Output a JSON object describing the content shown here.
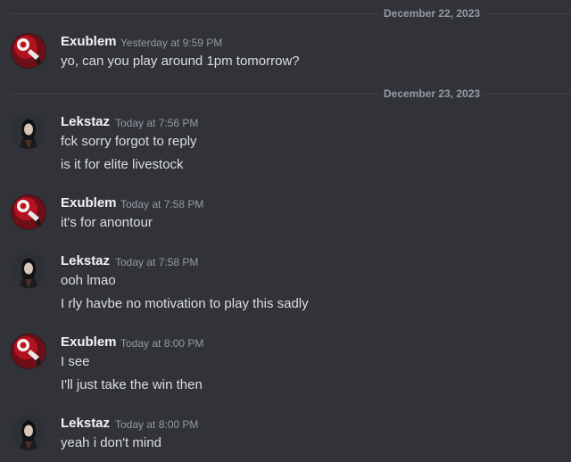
{
  "dividers": [
    {
      "date": "December 22, 2023"
    },
    {
      "date": "December 23, 2023"
    }
  ],
  "messages": [
    {
      "author": "Exublem",
      "avatar_icon": "red-lamp-avatar-icon",
      "timestamp": "Yesterday at 9:59 PM",
      "lines": [
        "yo, can you play around 1pm tomorrow?"
      ]
    },
    {
      "author": "Lekstaz",
      "avatar_icon": "dark-haired-character-avatar-icon",
      "timestamp": "Today at 7:56 PM",
      "lines": [
        "fck sorry forgot to reply",
        "is it for elite livestock"
      ]
    },
    {
      "author": "Exublem",
      "avatar_icon": "red-lamp-avatar-icon",
      "timestamp": "Today at 7:58 PM",
      "lines": [
        "it's for anontour"
      ]
    },
    {
      "author": "Lekstaz",
      "avatar_icon": "dark-haired-character-avatar-icon",
      "timestamp": "Today at 7:58 PM",
      "lines": [
        "ooh lmao",
        "I rly havbe no motivation to play this sadly"
      ]
    },
    {
      "author": "Exublem",
      "avatar_icon": "red-lamp-avatar-icon",
      "timestamp": "Today at 8:00 PM",
      "lines": [
        "I see",
        "I'll just take the win then"
      ]
    },
    {
      "author": "Lekstaz",
      "avatar_icon": "dark-haired-character-avatar-icon",
      "timestamp": "Today at 8:00 PM",
      "lines": [
        "yeah i don't mind"
      ]
    }
  ],
  "colors": {
    "background": "#313338",
    "author": "#f2f3f5",
    "text": "#dbdee1",
    "muted": "#949ba4",
    "divider": "#3f4147"
  }
}
